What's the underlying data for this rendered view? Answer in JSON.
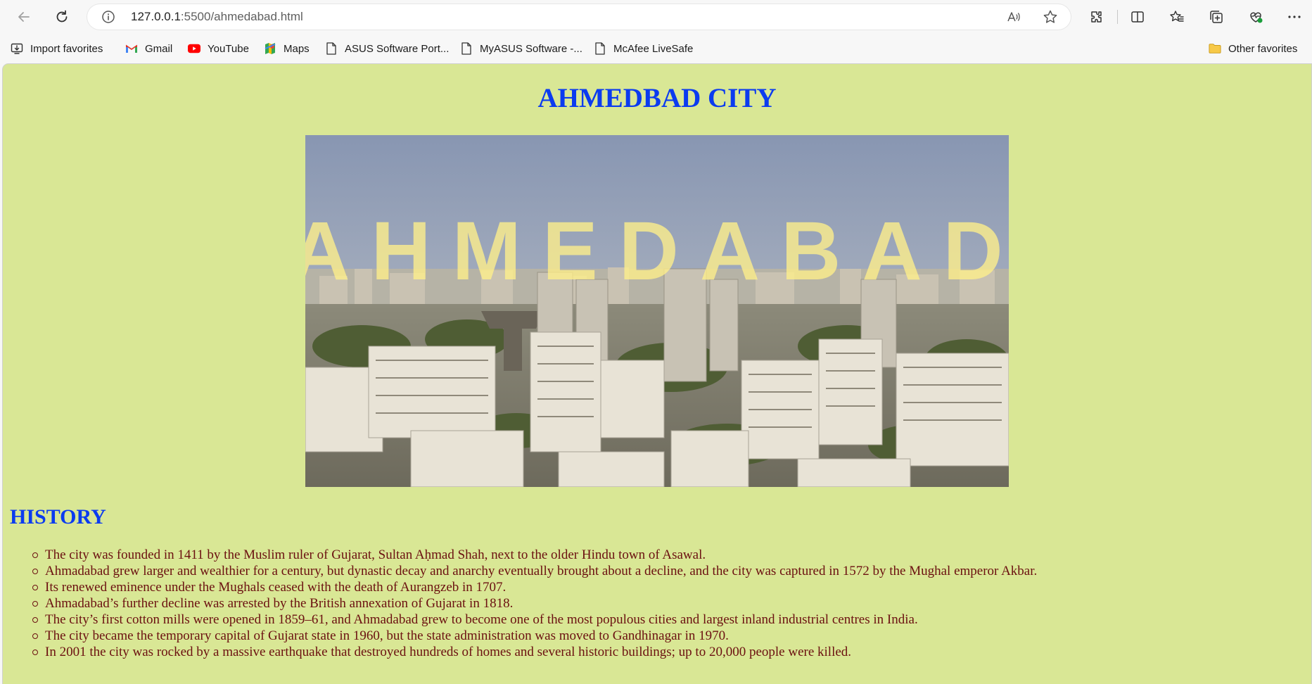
{
  "browser": {
    "url_host": "127.0.0.1",
    "url_path": ":5500/ahmedabad.html"
  },
  "favorites": [
    {
      "label": "Import favorites",
      "icon": "import-icon"
    },
    {
      "label": "Gmail",
      "icon": "gmail-icon"
    },
    {
      "label": "YouTube",
      "icon": "youtube-icon"
    },
    {
      "label": "Maps",
      "icon": "maps-icon"
    },
    {
      "label": "ASUS Software Port...",
      "icon": "page-icon"
    },
    {
      "label": "MyASUS Software -...",
      "icon": "page-icon"
    },
    {
      "label": "McAfee LiveSafe",
      "icon": "page-icon"
    },
    {
      "label": "Other favorites",
      "icon": "folder-icon"
    }
  ],
  "page": {
    "title": "AHMEDBAD CITY",
    "hero_overlay": "AHMEDABAD",
    "history_heading": "HISTORY",
    "history_items": [
      "The city was founded in 1411 by the Muslim ruler of Gujarat, Sultan Aḥmad Shah, next to the older Hindu town of Asawal.",
      "Ahmadabad grew larger and wealthier for a century, but dynastic decay and anarchy eventually brought about a decline, and the city was captured in 1572 by the Mughal emperor Akbar.",
      "Its renewed eminence under the Mughals ceased with the death of Aurangzeb in 1707.",
      "Ahmadabad’s further decline was arrested by the British annexation of Gujarat in 1818.",
      "The city’s first cotton mills were opened in 1859–61, and Ahmadabad grew to become one of the most populous cities and largest inland industrial centres in India.",
      "The city became the temporary capital of Gujarat state in 1960, but the state administration was moved to Gandhinagar in 1970.",
      "In 2001 the city was rocked by a massive earthquake that destroyed hundreds of homes and several historic buildings; up to 20,000 people were killed."
    ]
  },
  "colors": {
    "page_background": "#d9e795",
    "heading_blue": "#0b3bf0",
    "list_text": "#6b1010"
  }
}
